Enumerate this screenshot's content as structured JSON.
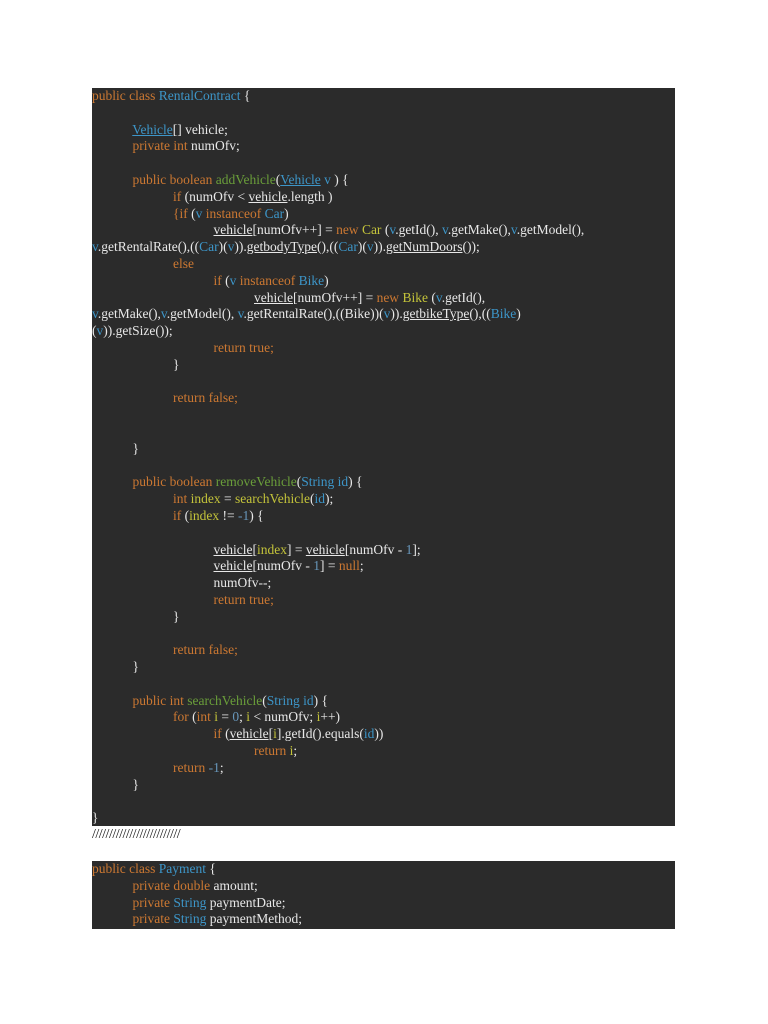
{
  "block1": {
    "lines": [
      [
        {
          "t": "public class ",
          "c": "kw"
        },
        {
          "t": "RentalContract",
          "c": "ty"
        },
        {
          "t": " {",
          "c": "pl"
        }
      ],
      [],
      [
        {
          "t": "            ",
          "c": "pl"
        },
        {
          "t": "Vehicle",
          "c": "ty ul"
        },
        {
          "t": "[] vehicle;",
          "c": "pl"
        }
      ],
      [
        {
          "t": "            private int ",
          "c": "kw"
        },
        {
          "t": "numOfv;",
          "c": "pl"
        }
      ],
      [],
      [
        {
          "t": "            public boolean ",
          "c": "kw"
        },
        {
          "t": "addVehicle",
          "c": "fn"
        },
        {
          "t": "(",
          "c": "pl"
        },
        {
          "t": "Vehicle",
          "c": "ty ul"
        },
        {
          "t": " v",
          "c": "ty"
        },
        {
          "t": " ) {",
          "c": "pl"
        }
      ],
      [
        {
          "t": "                        if ",
          "c": "kw"
        },
        {
          "t": "(numOfv < ",
          "c": "pl"
        },
        {
          "t": "vehicle",
          "c": "pl ul"
        },
        {
          "t": ".length )",
          "c": "pl"
        }
      ],
      [
        {
          "t": "                        {if ",
          "c": "kw"
        },
        {
          "t": "(",
          "c": "pl"
        },
        {
          "t": "v ",
          "c": "ty"
        },
        {
          "t": "instanceof ",
          "c": "kw"
        },
        {
          "t": "Car",
          "c": "ty"
        },
        {
          "t": ")",
          "c": "pl"
        }
      ],
      [
        {
          "t": "                                    ",
          "c": "pl"
        },
        {
          "t": "vehicle",
          "c": "pl ul"
        },
        {
          "t": "[numOfv++] = ",
          "c": "pl"
        },
        {
          "t": "new ",
          "c": "kw"
        },
        {
          "t": "Car",
          "c": "vr"
        },
        {
          "t": " (",
          "c": "pl"
        },
        {
          "t": "v",
          "c": "ty"
        },
        {
          "t": ".getId(), ",
          "c": "pl"
        },
        {
          "t": "v",
          "c": "ty"
        },
        {
          "t": ".getMake(),",
          "c": "pl"
        },
        {
          "t": "v",
          "c": "ty"
        },
        {
          "t": ".getModel(),",
          "c": "pl"
        }
      ],
      [
        {
          "t": "v",
          "c": "ty"
        },
        {
          "t": ".getRentalRate(),((",
          "c": "pl"
        },
        {
          "t": "Car",
          "c": "ty"
        },
        {
          "t": ")(",
          "c": "pl"
        },
        {
          "t": "v",
          "c": "ty"
        },
        {
          "t": ")).",
          "c": "pl"
        },
        {
          "t": "getbodyType",
          "c": "pl ul"
        },
        {
          "t": "(),((",
          "c": "pl"
        },
        {
          "t": "Car",
          "c": "ty"
        },
        {
          "t": ")(",
          "c": "pl"
        },
        {
          "t": "v",
          "c": "ty"
        },
        {
          "t": ")).",
          "c": "pl"
        },
        {
          "t": "getNumDoors",
          "c": "pl ul"
        },
        {
          "t": "());",
          "c": "pl"
        }
      ],
      [
        {
          "t": "                        else",
          "c": "kw"
        }
      ],
      [
        {
          "t": "                                    if ",
          "c": "kw"
        },
        {
          "t": "(",
          "c": "pl"
        },
        {
          "t": "v ",
          "c": "ty"
        },
        {
          "t": "instanceof ",
          "c": "kw"
        },
        {
          "t": "Bike",
          "c": "ty"
        },
        {
          "t": ")",
          "c": "pl"
        }
      ],
      [
        {
          "t": "                                                ",
          "c": "pl"
        },
        {
          "t": "vehicle",
          "c": "pl ul"
        },
        {
          "t": "[numOfv++] = ",
          "c": "pl"
        },
        {
          "t": "new ",
          "c": "kw"
        },
        {
          "t": "Bike",
          "c": "vr"
        },
        {
          "t": " (",
          "c": "pl"
        },
        {
          "t": "v",
          "c": "ty"
        },
        {
          "t": ".getId(),",
          "c": "pl"
        }
      ],
      [
        {
          "t": "v",
          "c": "ty"
        },
        {
          "t": ".getMake(),",
          "c": "pl"
        },
        {
          "t": "v",
          "c": "ty"
        },
        {
          "t": ".getModel(), ",
          "c": "pl"
        },
        {
          "t": "v",
          "c": "ty"
        },
        {
          "t": ".getRentalRate(),((Bike))(",
          "c": "pl"
        },
        {
          "t": "v",
          "c": "ty"
        },
        {
          "t": ")).",
          "c": "pl"
        },
        {
          "t": "getbikeType",
          "c": "pl ul"
        },
        {
          "t": "(),((",
          "c": "pl"
        },
        {
          "t": "Bike",
          "c": "ty"
        },
        {
          "t": ")",
          "c": "pl"
        }
      ],
      [
        {
          "t": "(",
          "c": "pl"
        },
        {
          "t": "v",
          "c": "ty"
        },
        {
          "t": ")).getSize());",
          "c": "pl"
        }
      ],
      [
        {
          "t": "                                    return true;",
          "c": "kw"
        }
      ],
      [
        {
          "t": "                        }",
          "c": "pl"
        }
      ],
      [],
      [
        {
          "t": "                        return false;",
          "c": "kw"
        }
      ],
      [],
      [],
      [
        {
          "t": "            }",
          "c": "pl"
        }
      ],
      [],
      [
        {
          "t": "            public boolean ",
          "c": "kw"
        },
        {
          "t": "removeVehicle",
          "c": "fn"
        },
        {
          "t": "(",
          "c": "pl"
        },
        {
          "t": "String ",
          "c": "ty"
        },
        {
          "t": "id",
          "c": "ty"
        },
        {
          "t": ") {",
          "c": "pl"
        }
      ],
      [
        {
          "t": "                        int ",
          "c": "kw"
        },
        {
          "t": "index",
          "c": "vr"
        },
        {
          "t": " = ",
          "c": "pl"
        },
        {
          "t": "searchVehicle",
          "c": "vr"
        },
        {
          "t": "(",
          "c": "pl"
        },
        {
          "t": "id",
          "c": "ty"
        },
        {
          "t": ");",
          "c": "pl"
        }
      ],
      [
        {
          "t": "                        if ",
          "c": "kw"
        },
        {
          "t": "(",
          "c": "pl"
        },
        {
          "t": "index",
          "c": "vr"
        },
        {
          "t": " != ",
          "c": "pl"
        },
        {
          "t": "-1",
          "c": "nm"
        },
        {
          "t": ") {",
          "c": "pl"
        }
      ],
      [],
      [
        {
          "t": "                                    ",
          "c": "pl"
        },
        {
          "t": "vehicle",
          "c": "pl ul"
        },
        {
          "t": "[",
          "c": "pl"
        },
        {
          "t": "index",
          "c": "vr"
        },
        {
          "t": "] = ",
          "c": "pl"
        },
        {
          "t": "vehicle",
          "c": "pl ul"
        },
        {
          "t": "[numOfv - ",
          "c": "pl"
        },
        {
          "t": "1",
          "c": "nm"
        },
        {
          "t": "];",
          "c": "pl"
        }
      ],
      [
        {
          "t": "                                    ",
          "c": "pl"
        },
        {
          "t": "vehicle",
          "c": "pl ul"
        },
        {
          "t": "[numOfv - ",
          "c": "pl"
        },
        {
          "t": "1",
          "c": "nm"
        },
        {
          "t": "] = ",
          "c": "pl"
        },
        {
          "t": "null",
          "c": "kw"
        },
        {
          "t": ";",
          "c": "pl"
        }
      ],
      [
        {
          "t": "                                    numOfv--;",
          "c": "pl"
        }
      ],
      [
        {
          "t": "                                    return true;",
          "c": "kw"
        }
      ],
      [
        {
          "t": "                        }",
          "c": "pl"
        }
      ],
      [],
      [
        {
          "t": "                        return false;",
          "c": "kw"
        }
      ],
      [
        {
          "t": "            }",
          "c": "pl"
        }
      ],
      [],
      [
        {
          "t": "            public int ",
          "c": "kw"
        },
        {
          "t": "searchVehicle",
          "c": "fn"
        },
        {
          "t": "(",
          "c": "pl"
        },
        {
          "t": "String ",
          "c": "ty"
        },
        {
          "t": "id",
          "c": "ty"
        },
        {
          "t": ") {",
          "c": "pl"
        }
      ],
      [
        {
          "t": "                        for ",
          "c": "kw"
        },
        {
          "t": "(",
          "c": "pl"
        },
        {
          "t": "int ",
          "c": "kw"
        },
        {
          "t": "i",
          "c": "vr"
        },
        {
          "t": " = ",
          "c": "pl"
        },
        {
          "t": "0",
          "c": "nm"
        },
        {
          "t": "; ",
          "c": "pl"
        },
        {
          "t": "i",
          "c": "vr"
        },
        {
          "t": " < numOfv; ",
          "c": "pl"
        },
        {
          "t": "i",
          "c": "vr"
        },
        {
          "t": "++)",
          "c": "pl"
        }
      ],
      [
        {
          "t": "                                    if ",
          "c": "kw"
        },
        {
          "t": "(",
          "c": "pl"
        },
        {
          "t": "vehicle",
          "c": "pl ul"
        },
        {
          "t": "[",
          "c": "pl"
        },
        {
          "t": "i",
          "c": "vr"
        },
        {
          "t": "].getId().equals(",
          "c": "pl"
        },
        {
          "t": "id",
          "c": "ty"
        },
        {
          "t": "))",
          "c": "pl"
        }
      ],
      [
        {
          "t": "                                                return ",
          "c": "kw"
        },
        {
          "t": "i",
          "c": "vr"
        },
        {
          "t": ";",
          "c": "pl"
        }
      ],
      [
        {
          "t": "                        return ",
          "c": "kw"
        },
        {
          "t": "-1",
          "c": "nm"
        },
        {
          "t": ";",
          "c": "pl"
        }
      ],
      [
        {
          "t": "            }",
          "c": "pl"
        }
      ],
      [],
      [
        {
          "t": "}",
          "c": "pl"
        }
      ]
    ]
  },
  "separator": "//////////////////////////",
  "block2": {
    "lines": [
      [
        {
          "t": "public class ",
          "c": "kw"
        },
        {
          "t": "Payment",
          "c": "ty"
        },
        {
          "t": " {",
          "c": "pl"
        }
      ],
      [
        {
          "t": "            private double ",
          "c": "kw"
        },
        {
          "t": "amount;",
          "c": "pl"
        }
      ],
      [
        {
          "t": "            private ",
          "c": "kw"
        },
        {
          "t": "String ",
          "c": "ty"
        },
        {
          "t": "paymentDate;",
          "c": "pl"
        }
      ],
      [
        {
          "t": "            private ",
          "c": "kw"
        },
        {
          "t": "String ",
          "c": "ty"
        },
        {
          "t": "paymentMethod;",
          "c": "pl"
        }
      ]
    ]
  }
}
